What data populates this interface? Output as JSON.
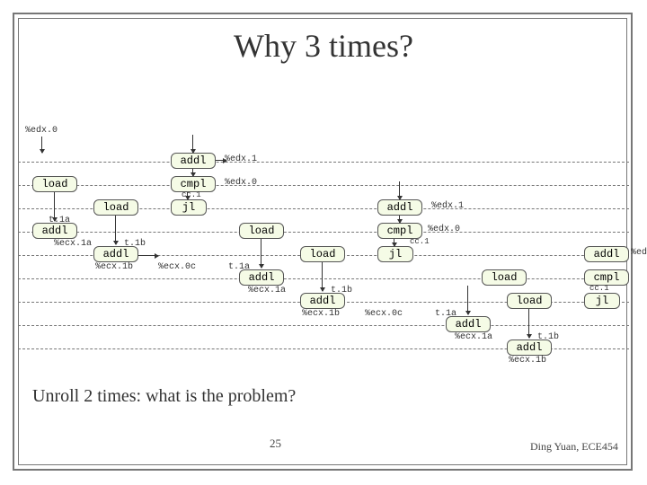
{
  "title": "Why 3 times?",
  "subtitle": "Unroll 2 times: what is the problem?",
  "page_number": "25",
  "credit": "Ding Yuan, ECE454",
  "ops": {
    "addl": "addl",
    "cmpl": "cmpl",
    "jl": "jl",
    "load": "load"
  },
  "regs": {
    "edx0": "%edx.0",
    "edx1": "%edx.1",
    "cc1": "cc.1",
    "t1a": "t.1a",
    "ecx1a": "%ecx.1a",
    "t1b": "t.1b",
    "ecx1b": "%ecx.1b",
    "ecx0c": "%ecx.0c",
    "edx": "%edx."
  },
  "chart_data": {
    "type": "diagram",
    "description": "Pipeline unrolling dependency graph showing three iterations of a loop body (addl/cmpl/jl/load/addl/addl) connected by data-dependency arrows, overlaid on dashed clock-cycle lines.",
    "iteration_ops": [
      "addl",
      "cmpl",
      "jl",
      "load",
      "addl",
      "load",
      "addl"
    ],
    "edge_labels": [
      "%edx.0",
      "%edx.1",
      "cc.1",
      "t.1a",
      "%ecx.1a",
      "t.1b",
      "%ecx.1b",
      "%ecx.0c"
    ],
    "iterations_shown": 3,
    "cycle_lines": 9
  }
}
